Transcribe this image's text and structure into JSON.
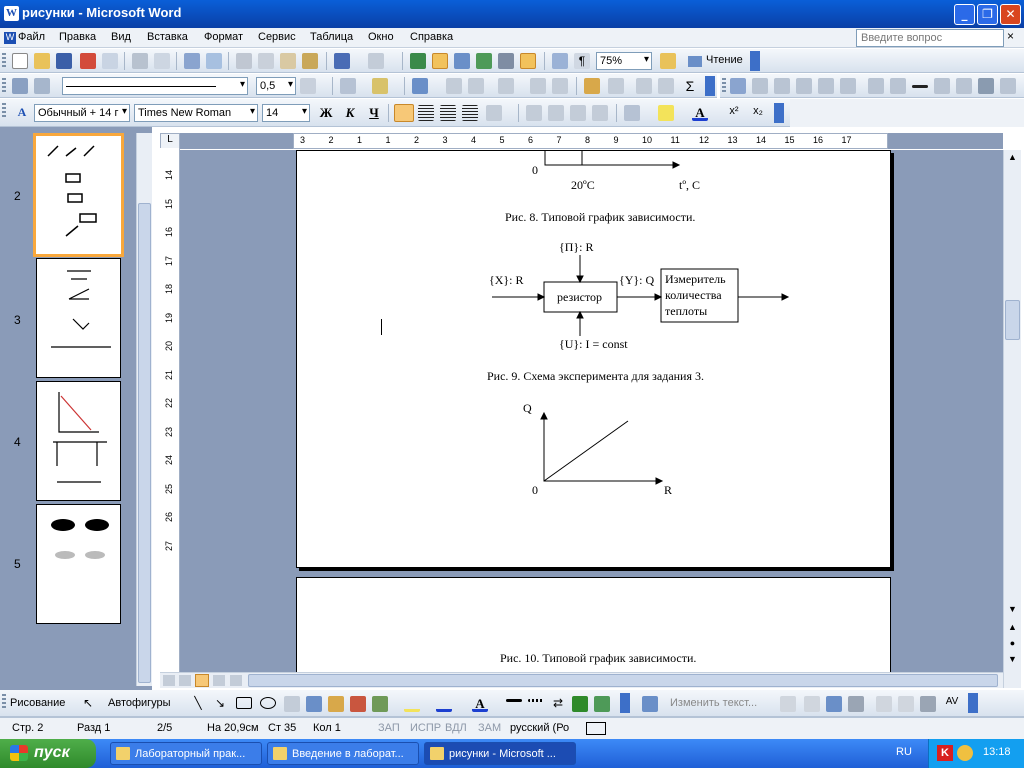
{
  "window": {
    "title": "рисунки - Microsoft Word",
    "icon": "W"
  },
  "menu": [
    "Файл",
    "Правка",
    "Вид",
    "Вставка",
    "Формат",
    "Сервис",
    "Таблица",
    "Окно",
    "Справка"
  ],
  "ask_placeholder": "Введите вопрос",
  "toolbar1": {
    "zoom": "75%",
    "reading": "Чтение"
  },
  "toolbar2": {
    "line_width": "0,5"
  },
  "toolbar3": {
    "style": "Обычный + 14 г",
    "font": "Times New Roman",
    "size": "14",
    "bold": "Ж",
    "italic": "К",
    "underline": "Ч"
  },
  "thumbnails": [
    {
      "num": "2"
    },
    {
      "num": "3"
    },
    {
      "num": "4"
    },
    {
      "num": "5"
    }
  ],
  "vruler_labels": [
    "14",
    "15",
    "16",
    "17",
    "18",
    "19",
    "20",
    "21",
    "22",
    "23",
    "24",
    "25",
    "26",
    "27"
  ],
  "hruler_labels": [
    "3",
    "2",
    "1",
    "1",
    "2",
    "3",
    "4",
    "5",
    "6",
    "7",
    "8",
    "9",
    "10",
    "11",
    "12",
    "13",
    "14",
    "15",
    "16",
    "17"
  ],
  "doc": {
    "fig8_axis_zero": "0",
    "fig8_tick": "20ºС",
    "fig8_xlabel": "tº, С",
    "fig8_caption": "Рис. 8. Типовой график зависимости.",
    "fig9_p": "{П}: R",
    "fig9_x": "{X}: R",
    "fig9_y": "{Y}: Q",
    "fig9_u": "{U}: I = const",
    "fig9_box1": "резистор",
    "fig9_box2_l1": "Измеритель",
    "fig9_box2_l2": "количества",
    "fig9_box2_l3": "теплоты",
    "fig9_caption": "Рис. 9. Схема эксперимента для задания 3.",
    "fig_q": "Q",
    "fig_zero": "0",
    "fig_r": "R",
    "fig10_caption": "Рис. 10. Типовой график зависимости."
  },
  "drawbar": {
    "draw": "Рисование",
    "autoshapes": "Автофигуры",
    "edit_text": "Изменить текст..."
  },
  "status": {
    "page": "Стр. 2",
    "section": "Разд 1",
    "pages": "2/5",
    "at": "На 20,9см",
    "line": "Ст 35",
    "col": "Кол 1",
    "rec": "ЗАП",
    "trk": "ИСПР",
    "ext": "ВДЛ",
    "ovr": "ЗАМ",
    "lang": "русский (Ро"
  },
  "taskbar": {
    "start": "пуск",
    "tasks": [
      "Лабораторный прак...",
      "Введение в лаборат...",
      "рисунки - Microsoft ..."
    ],
    "lang": "RU",
    "time": "13:18"
  }
}
